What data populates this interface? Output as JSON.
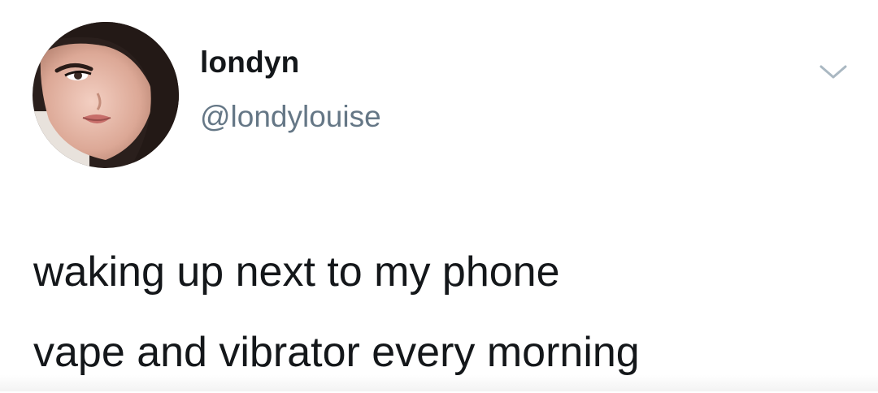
{
  "tweet": {
    "author": {
      "display_name": "londyn",
      "handle": "@londylouise",
      "avatar_icon": "profile-photo"
    },
    "menu_icon": "chevron-down-icon",
    "text_lines": [
      "waking up next to my phone",
      "vape and vibrator every morning"
    ]
  },
  "colors": {
    "text_primary": "#14171a",
    "text_secondary": "#657786",
    "caret": "#aab8c2",
    "background": "#ffffff"
  }
}
